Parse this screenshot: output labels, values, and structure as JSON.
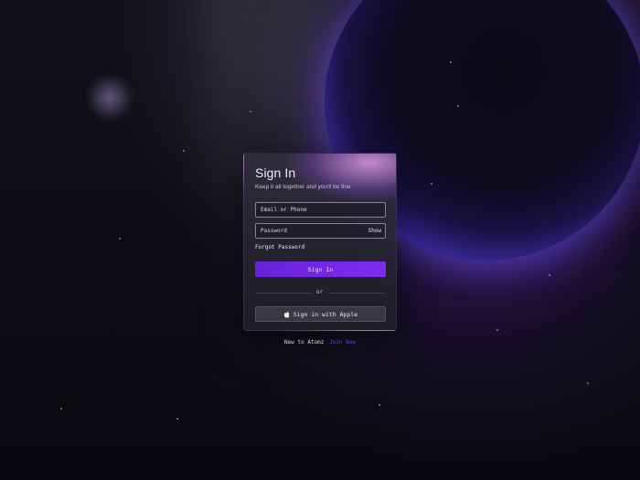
{
  "login": {
    "title": "Sign In",
    "subtitle": "Keep it all together and you'll be fine",
    "email_placeholder": "Email or Phone",
    "password_placeholder": "Password",
    "show_label": "Show",
    "forgot_label": "Forgot Password",
    "signin_label": "Sign In",
    "or_label": "or",
    "apple_label": "Sign in with Apple",
    "apple_icon": "apple-icon"
  },
  "footer": {
    "prompt": "New to Atomz",
    "join_label": "Join Now"
  },
  "colors": {
    "accent": "#7d2bf0",
    "link": "#5a3bff",
    "background": "#0c0b10"
  }
}
